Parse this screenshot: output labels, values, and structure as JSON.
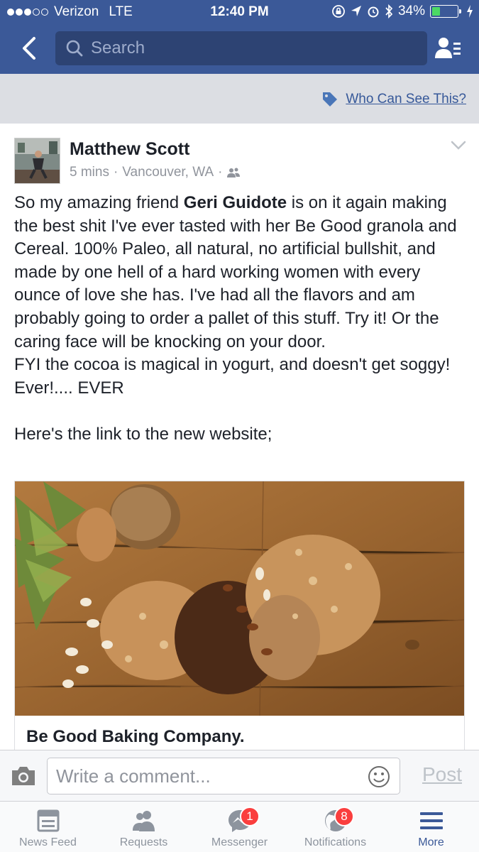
{
  "status_bar": {
    "carrier": "Verizon",
    "network": "LTE",
    "time": "12:40 PM",
    "battery": "34%",
    "battery_level": 0.34
  },
  "header": {
    "search_placeholder": "Search"
  },
  "privacy": {
    "label": "Who Can See This?"
  },
  "post": {
    "author": "Matthew Scott",
    "time": "5 mins",
    "separator": "·",
    "location": "Vancouver, WA",
    "text_before_mention": "So my amazing friend ",
    "mention": "Geri Guidote",
    "text_after_mention": " is on it again making the best shit I've ever tasted with her Be Good granola and Cereal. 100% Paleo,  all natural, no artificial bullshit, and made by one hell of a hard working women with every ounce of love she has. I've had all the flavors and am probably going to order a pallet of this stuff.  Try it! Or the caring face will be knocking on your door.\nFYI the cocoa is magical in yogurt, and doesn't get soggy! Ever!.... EVER\n\nHere's the link to the new website;",
    "link_title": "Be Good Baking Company."
  },
  "comment": {
    "placeholder": "Write a comment...",
    "post_label": "Post"
  },
  "tabs": [
    {
      "label": "News Feed",
      "icon": "news-feed-icon"
    },
    {
      "label": "Requests",
      "icon": "friend-requests-icon"
    },
    {
      "label": "Messenger",
      "icon": "messenger-icon",
      "badge": "1"
    },
    {
      "label": "Notifications",
      "icon": "globe-icon",
      "badge": "8"
    },
    {
      "label": "More",
      "icon": "menu-icon",
      "active": true
    }
  ],
  "colors": {
    "brand_blue": "#3b5998",
    "link_blue": "#365899",
    "badge_red": "#fa3e3e",
    "battery_green": "#4cd964"
  }
}
